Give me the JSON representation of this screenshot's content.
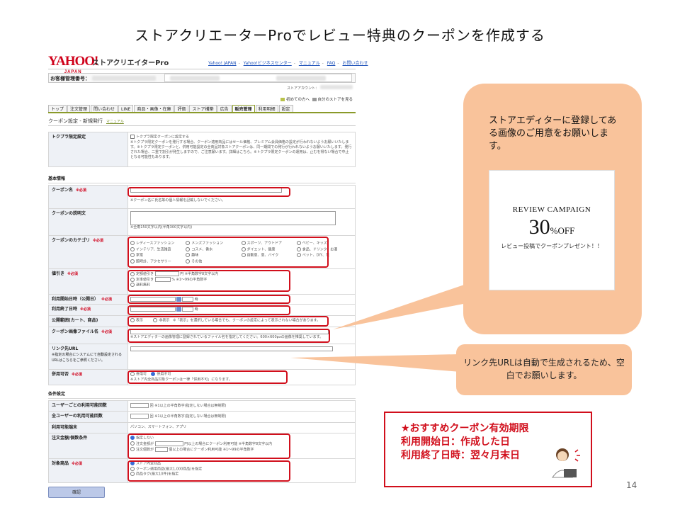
{
  "slide": {
    "title": "ストアクリエーターProでレビュー特典のクーポンを作成する",
    "page_number": "14"
  },
  "header": {
    "logo": "YAHOO!",
    "logo_sub": "JAPAN",
    "app_name": "ストアクリエイターPro",
    "links": [
      "Yahoo! JAPAN",
      "Yahoo!ビジネスセンター",
      "マニュアル",
      "FAQ",
      "お問い合わせ"
    ],
    "customer_label": "お客様管理番号：",
    "account_label": "ストアアカウント：",
    "util_links": [
      "初めての方へ",
      "自分のストアを見る"
    ]
  },
  "tabs": [
    "トップ",
    "注文管理",
    "問い合わせ",
    "LINE",
    "商品・画像・在庫",
    "評価",
    "ストア構築",
    "広告",
    "販売管理",
    "利用明細",
    "設定"
  ],
  "active_tab": "販売管理",
  "page_heading": "クーポン設定 - 新規発行",
  "manual_tag": "マニュアル",
  "form": {
    "tokuchoku": {
      "label": "トクプラ限定設定",
      "checkbox": "トクプラ限定クーポンに設定する",
      "note": "※トクプラ限定クーポンを発行する場合、クーポン適用商品にはセール価格、プレミアム会員価格の設定が行われないようお願いいたします。※トクプラ限定クーポンと、併用可能設定の全商品対象ストアクーポンは、同一期間での発行が行われないようお願いいたします。発行された場合、二重で割引が発生しますので、ご注意願います。詳細はこちら。※トクプラ限定クーポンの運用は、止むを得ない場合で中止となる可能性もあります。"
    },
    "basic_section": "基本情報",
    "required": "※必須",
    "coupon_name": {
      "label": "クーポン名",
      "note": "※クーポン名に氏名等の個人情報を記載しないでください。"
    },
    "coupon_desc": {
      "label": "クーポンの説明文",
      "note": "※全角150文字以内(半角300文字以内)"
    },
    "category": {
      "label": "クーポンのカテゴリ",
      "options": [
        "レディースファッション",
        "メンズファッション",
        "スポーツ、アウトドア",
        "ベビー、キッズ",
        "インテリア、生活雑貨",
        "コスメ、香水",
        "ダイエット、健康",
        "食品、ドリンク、お酒",
        "家電",
        "趣味",
        "自動車、車、バイク",
        "ペット、DIY、花",
        "腕時計、アクセサリー",
        "その他"
      ]
    },
    "discount": {
      "label": "値引き",
      "opt1": "定額値引き",
      "opt1_unit": "円",
      "opt1_note": "※半角数字8文字以内",
      "opt2": "定率値引き",
      "opt2_unit": "%",
      "opt2_note": "※1〜99の半角数字",
      "opt3": "送料無料"
    },
    "start": {
      "label": "利用開始日時（公開日）",
      "unit": "時"
    },
    "end": {
      "label": "利用終了日時",
      "unit": "時"
    },
    "scope": {
      "label": "公開範囲(カート、商品)",
      "opt1": "表示",
      "opt2": "非表示",
      "note": "※「表示」を選択している場合でも、クーポンの設定によって表示されない場合があります。"
    },
    "image": {
      "label": "クーポン画像ファイル名",
      "note": "※ストアエディターの画像管理に登録されているファイル名を指定してください。600×600pxの画像を推奨しています。"
    },
    "link": {
      "label": "リンク先URL",
      "sub": "※指定の場合にシステムにて自動設定されるURLはこちらをご参照ください。"
    },
    "combine": {
      "label": "併用可否",
      "opt1": "併用可",
      "opt2": "併用不可",
      "note": "※ストア内全商品対象クーポンは一律「併用不可」になります。"
    },
    "condition_section": "条件設定",
    "per_user": {
      "label": "ユーザーごとの利用可能回数",
      "unit": "回",
      "note": "※1以上の半角数字(指定しない場合は無制限)"
    },
    "all_users": {
      "label": "全ユーザーの利用可能回数",
      "unit": "回",
      "note": "※1以上の半角数字(指定しない場合は無制限)"
    },
    "device": {
      "label": "利用可能端末",
      "value": "パソコン、スマートフォン、アプリ"
    },
    "order_cond": {
      "label": "注文金額/個数条件",
      "opt1": "指定しない",
      "opt2": "注文金額が",
      "opt2_note": "円以上の場合にクーポン利用可能",
      "opt2_note2": "※半角数字8文字以内",
      "opt3": "注文個数が",
      "opt3_note": "個以上の場合にクーポン利用可能",
      "opt3_note2": "※1〜99の半角数字"
    },
    "target": {
      "label": "対象商品",
      "opt1": "ストア内全商品",
      "opt2": "クーポン適用商品(最大1,000商品)を指定",
      "opt3": "商品タグ(最大10件)を指定"
    },
    "confirm": "確認"
  },
  "callout_editor": {
    "text": "ストアエディターに登録してある画像のご用意をお願いします。",
    "sample_title": "REVIEW CAMPAIGN",
    "sample_pct": "30",
    "sample_off": "%OFF",
    "sample_sub": "レビュー投稿でクーポンプレゼント！！"
  },
  "callout_url": {
    "text": "リンク先URLは自動で生成されるため、空白でお願いします。"
  },
  "tip": {
    "line1": "★おすすめクーポン有効期限",
    "line2": "利用開始日：作成した日",
    "line3": "利用終了日時：翌々月末日"
  },
  "colors": {
    "highlight": "#d10f1c",
    "callout": "#f9c39b",
    "accent_tab": "#8a9a2a"
  }
}
